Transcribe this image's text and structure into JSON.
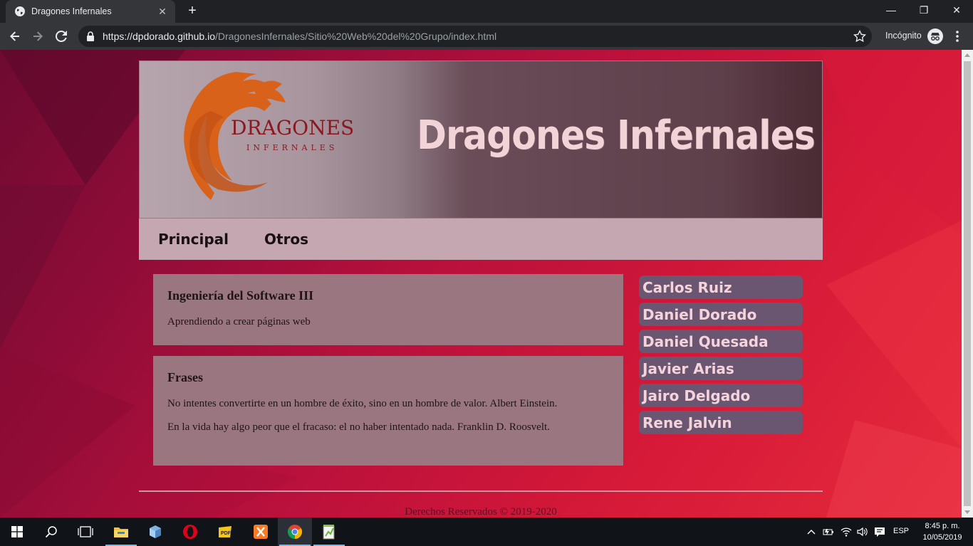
{
  "browser": {
    "tab_title": "Dragones Infernales",
    "tab_close": "✕",
    "new_tab": "+",
    "url_host": "https://dpdorado.github.io",
    "url_path": "/DragonesInfernales/Sitio%20Web%20del%20Grupo/index.html",
    "profile_label": "Incógnito",
    "window_controls": {
      "minimize": "—",
      "restore": "❐",
      "close": "✕"
    }
  },
  "page": {
    "logo_text": "DRAGONES",
    "logo_subtext": "INFERNALES",
    "site_title": "Dragones Infernales",
    "nav": [
      {
        "label": "Principal"
      },
      {
        "label": "Otros"
      }
    ],
    "cards": [
      {
        "title": "Ingeniería del Software III",
        "paragraphs": [
          "Aprendiendo a crear páginas web"
        ]
      },
      {
        "title": "Frases",
        "paragraphs": [
          "No intentes convertirte en un hombre de éxito, sino en un hombre de valor. Albert Einstein.",
          "En la vida hay algo peor que el fracaso: el no haber intentado nada. Franklin D. Roosvelt."
        ]
      }
    ],
    "members": [
      "Carlos Ruiz",
      "Daniel Dorado",
      "Daniel Quesada",
      "Javier Arias",
      "Jairo Delgado",
      "Rene Jalvin"
    ],
    "footer": "Derechos Reservados © 2019-2020"
  },
  "taskbar": {
    "apps": [
      "start-icon",
      "search-icon",
      "task-view-icon",
      "file-explorer-icon",
      "box-app-icon",
      "opera-icon",
      "pdf-app-icon",
      "xampp-icon",
      "chrome-icon",
      "notepad-plus-icon"
    ],
    "language": "ESP",
    "time": "8:45 p. m.",
    "date": "10/05/2019"
  },
  "colors": {
    "accent_banner_text": "#f2d3d8",
    "nav_background": "#c4a7b0",
    "card_background": "#9a7680",
    "member_background": "#6a5670",
    "logo_orange": "#d9621a"
  }
}
